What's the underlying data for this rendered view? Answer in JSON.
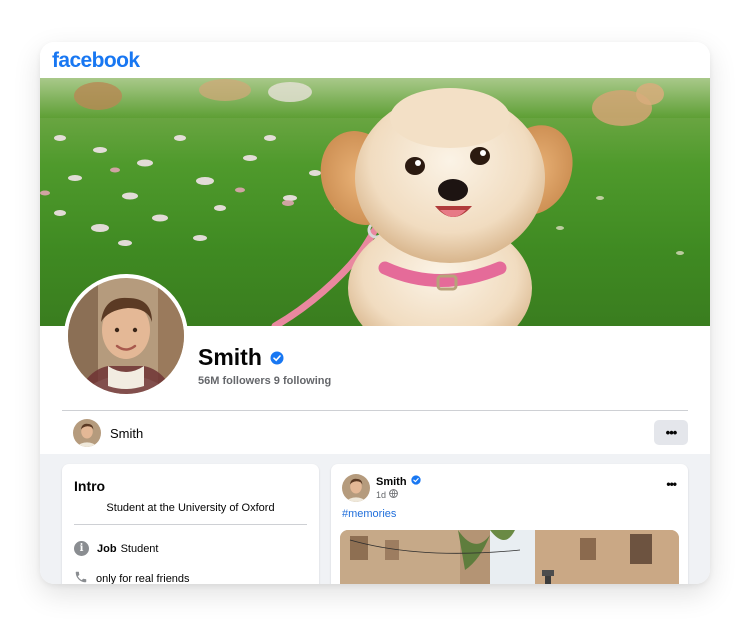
{
  "app": {
    "logo": "facebook"
  },
  "profile": {
    "name": "Smith",
    "followers_text": "56M followers 9 following"
  },
  "subbar": {
    "name": "Smith",
    "more_label": "•••"
  },
  "intro": {
    "title": "Intro",
    "bio": "Student at the University of Oxford",
    "rows": [
      {
        "icon": "info-icon",
        "label": "Job",
        "value": "Student"
      },
      {
        "icon": "phone-icon",
        "value": "only for real friends"
      }
    ]
  },
  "post": {
    "author": "Smith",
    "time": "1d",
    "tag": "#memories",
    "more_label": "•••"
  },
  "colors": {
    "brand": "#1877f2",
    "link": "#216fdb",
    "secondary_text": "#65676b",
    "button_bg": "#e4e6eb",
    "feed_bg": "#f0f2f5"
  }
}
